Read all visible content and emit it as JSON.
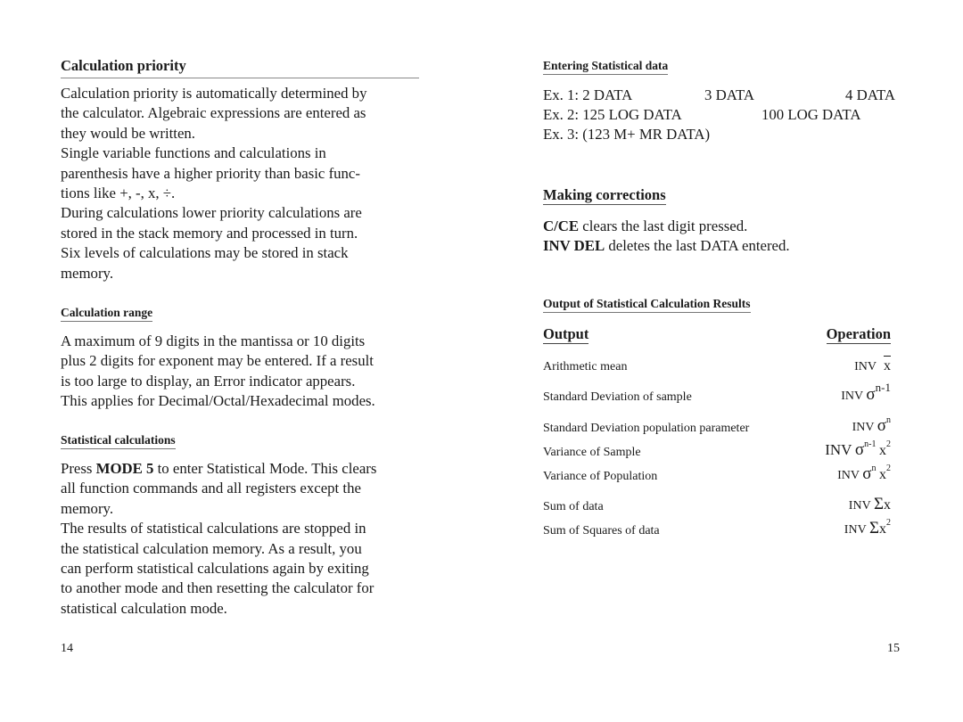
{
  "left_page": {
    "calc_priority": {
      "heading": "Calculation priority",
      "lines": [
        "Calculation priority is automatically determined by",
        "the calculator. Algebraic expressions are entered as",
        "they would be written.",
        "Single variable functions and calculations in",
        "parenthesis have a higher priority than basic func-",
        "tions like +, -, x, ÷.",
        "During calculations lower priority calculations are",
        "stored in the stack memory and processed in turn.",
        "Six levels of calculations may be stored in stack",
        "memory."
      ]
    },
    "calc_range": {
      "heading": "Calculation range",
      "lines": [
        "A maximum of 9 digits in the mantissa or 10 digits",
        "plus 2 digits for exponent may be entered. If a result",
        "is too large to display, an Error indicator appears.",
        "This applies for Decimal/Octal/Hexadecimal modes."
      ]
    },
    "stat_calc": {
      "heading": "Statistical calculations",
      "line1_pre": "Press ",
      "line1_bold": "MODE 5",
      "line1_post": " to enter Statistical Mode. This clears",
      "lines": [
        "all function commands and all registers except the",
        "memory.",
        "The results of statistical calculations are stopped in",
        "the statistical calculation memory. As a result, you",
        "can perform statistical calculations again by exiting",
        "to another mode and then resetting the calculator for",
        "statistical calculation mode."
      ]
    },
    "page_number": "14"
  },
  "right_page": {
    "entering": {
      "heading": "Entering Statistical data",
      "ex1": [
        "Ex. 1: 2 DATA",
        "3 DATA",
        "4 DATA"
      ],
      "ex2": [
        "Ex. 2: 125 LOG DATA",
        "100 LOG DATA"
      ],
      "ex3": "Ex. 3: (123  M+  MR  DATA)"
    },
    "corrections": {
      "heading": "Making corrections",
      "items": [
        {
          "key": "C/CE",
          "text": " clears the last digit pressed."
        },
        {
          "key": "INV DEL",
          "text": " deletes the last DATA entered."
        }
      ]
    },
    "output_results": {
      "heading": "Output of Statistical Calculation Results",
      "col_output": "Output",
      "col_operation": "Operation",
      "rows": [
        {
          "output": "Arithmetic mean",
          "inv": "INV",
          "sym": "x",
          "sup": "",
          "tail": "",
          "tail_sup": ""
        },
        {
          "output": "Standard Deviation of sample",
          "inv": "INV",
          "sym": "σ",
          "sup": "n-1",
          "tail": "",
          "tail_sup": ""
        },
        {
          "output": "Standard Deviation population parameter",
          "inv": "INV",
          "sym": "σ",
          "sup": "n",
          "tail": "",
          "tail_sup": ""
        },
        {
          "output": "Variance of Sample",
          "inv": "INV",
          "sym": "σ",
          "sup": "n-1",
          "tail": "x",
          "tail_sup": "2"
        },
        {
          "output": "Variance of Population",
          "inv": "INV",
          "sym": "σ",
          "sup": "n",
          "tail": "x",
          "tail_sup": "2"
        },
        {
          "output": "Sum of data",
          "inv": "INV",
          "sym": "Σ",
          "sup": "",
          "tail": "x",
          "tail_sup": ""
        },
        {
          "output": "Sum of Squares of data",
          "inv": "INV",
          "sym": "Σ",
          "sup": "",
          "tail": "x",
          "tail_sup": "2"
        }
      ]
    },
    "page_number": "15"
  }
}
